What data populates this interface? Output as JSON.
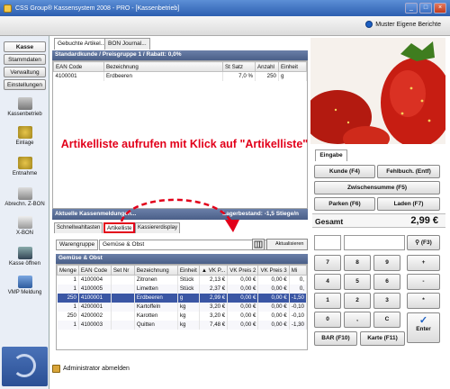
{
  "window": {
    "title": "CSS Group® Kassensystem 2008 - PRO - [Kassenbetrieb]",
    "muster_label": "Muster Eigene Berichte"
  },
  "nav": {
    "tabs": [
      "Kasse",
      "Stammdaten",
      "Verwaltung",
      "Einstellungen"
    ],
    "items": [
      {
        "label": "Kassenbetrieb",
        "icon": "cash-register-icon"
      },
      {
        "label": "Einlage",
        "icon": "coins-in-icon"
      },
      {
        "label": "Entnahme",
        "icon": "coins-out-icon"
      },
      {
        "label": "Abrechn. Z-BON",
        "icon": "printer-icon"
      },
      {
        "label": "X-BON",
        "icon": "receipt-icon"
      },
      {
        "label": "Kasse öffnen",
        "icon": "key-icon"
      },
      {
        "label": "VMP Meldung",
        "icon": "monitor-icon"
      }
    ]
  },
  "doc_tabs": [
    "Gebuchte Artikel...",
    "BON Journal..."
  ],
  "customer_bar": "Standardkunde / Preisgruppe 1 / Rabatt: 0,0%",
  "sales": {
    "columns": [
      "EAN Code",
      "Bezeichnung",
      "St Satz",
      "Anzahl",
      "Einheit"
    ],
    "rows": [
      {
        "ean": "4100001",
        "name": "Erdbeeren",
        "satz": "7,0 %",
        "anzahl": "250",
        "einheit": "g"
      }
    ]
  },
  "meldungen": {
    "label": "Aktuelle Kassenmeldungen...",
    "lager": "Lagerbestand: -1,5 Stiege/n"
  },
  "sub_tabs": [
    "Schnellwahltasten",
    "Artikelliste",
    "Kassiererdisplay"
  ],
  "warengruppe": {
    "label": "Warengruppe",
    "value": "Gemüse & Obst",
    "refresh": "Aktualisieren"
  },
  "group_header": "Gemüse & Obst",
  "articles": {
    "columns": [
      "Menge",
      "EAN Code",
      "Set Nr",
      "Bezeichnung",
      "Einheit",
      "▲ VK P...",
      "VK Preis 2",
      "VK Preis 3",
      "Mi"
    ],
    "rows": [
      {
        "menge": "1",
        "ean": "4100004",
        "set": "",
        "name": "Zitronen",
        "einheit": "Stück",
        "vk1": "2,13 €",
        "vk2": "0,00 €",
        "vk3": "0,00 €",
        "mi": "0,"
      },
      {
        "menge": "1",
        "ean": "4100005",
        "set": "",
        "name": "Limetten",
        "einheit": "Stück",
        "vk1": "2,37 €",
        "vk2": "0,00 €",
        "vk3": "0,00 €",
        "mi": "0,"
      },
      {
        "menge": "250",
        "ean": "4100001",
        "set": "",
        "name": "Erdbeeren",
        "einheit": "g",
        "vk1": "2,99 €",
        "vk2": "0,00 €",
        "vk3": "0,00 €",
        "mi": "-1,50"
      },
      {
        "menge": "1",
        "ean": "4200001",
        "set": "",
        "name": "Kartoffeln",
        "einheit": "kg",
        "vk1": "3,20 €",
        "vk2": "0,00 €",
        "vk3": "0,00 €",
        "mi": "-0,10"
      },
      {
        "menge": "250",
        "ean": "4200002",
        "set": "",
        "name": "Karotten",
        "einheit": "kg",
        "vk1": "3,20 €",
        "vk2": "0,00 €",
        "vk3": "0,00 €",
        "mi": "-0,10"
      },
      {
        "menge": "1",
        "ean": "4100003",
        "set": "",
        "name": "Quitten",
        "einheit": "kg",
        "vk1": "7,48 €",
        "vk2": "0,00 €",
        "vk3": "0,00 €",
        "mi": "-1,30"
      }
    ]
  },
  "admin_label": "Administrator abmelden",
  "annotation": "Artikelliste aufrufen mit Klick auf \"Artikelliste\"",
  "eingabe": {
    "tab": "Eingabe",
    "buttons": {
      "kunde": "Kunde (F4)",
      "fehlbuch": "Fehlbuch. (Entf)",
      "zwischensumme": "Zwischensumme (F5)",
      "parken": "Parken (F6)",
      "laden": "Laden (F7)",
      "search": "(F3)",
      "bar": "BAR (F10)",
      "karte": "Karte (F11)",
      "enter": "Enter"
    },
    "gesamt_label": "Gesamt",
    "gesamt_value": "2,99 €",
    "keypad": [
      "7",
      "8",
      "9",
      "+",
      "4",
      "5",
      "6",
      "-",
      "1",
      "2",
      "3",
      "*",
      "0",
      ",",
      "C"
    ]
  },
  "colors": {
    "header_blue": "#4a5f88",
    "selection": "#3a56a4",
    "annotation_red": "#e2001a"
  }
}
